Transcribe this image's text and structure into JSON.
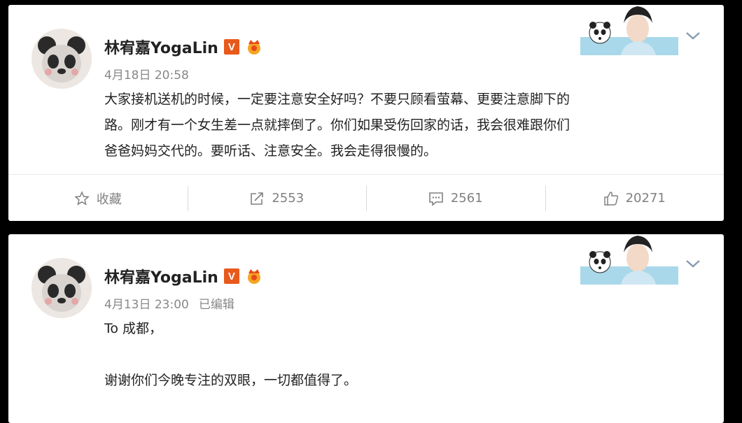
{
  "posts": [
    {
      "author": "林宥嘉YogaLin",
      "verified_label": "V",
      "time": "4月18日 20:58",
      "edited": "",
      "text_lines": [
        "大家接机送机的时候，一定要注意安全好吗？不要只顾看萤幕、更要注意脚下的",
        "路。刚才有一个女生差一点就摔倒了。你们如果受伤回家的话，我会很难跟你们",
        "爸爸妈妈交代的。要听话、注意安全。我会走得很慢的。"
      ],
      "actions": {
        "favorite_label": "收藏",
        "repost_count": "2553",
        "comment_count": "2561",
        "like_count": "20271"
      }
    },
    {
      "author": "林宥嘉YogaLin",
      "verified_label": "V",
      "time": "4月13日 23:00",
      "edited": "已编辑",
      "text_lines": [
        "To 成都，",
        "",
        "谢谢你们今晚专注的双眼，一切都值得了。"
      ]
    }
  ],
  "colors": {
    "background": "#000000",
    "card": "#ffffff",
    "verified_badge": "#e8591c",
    "action_text": "#808080"
  }
}
